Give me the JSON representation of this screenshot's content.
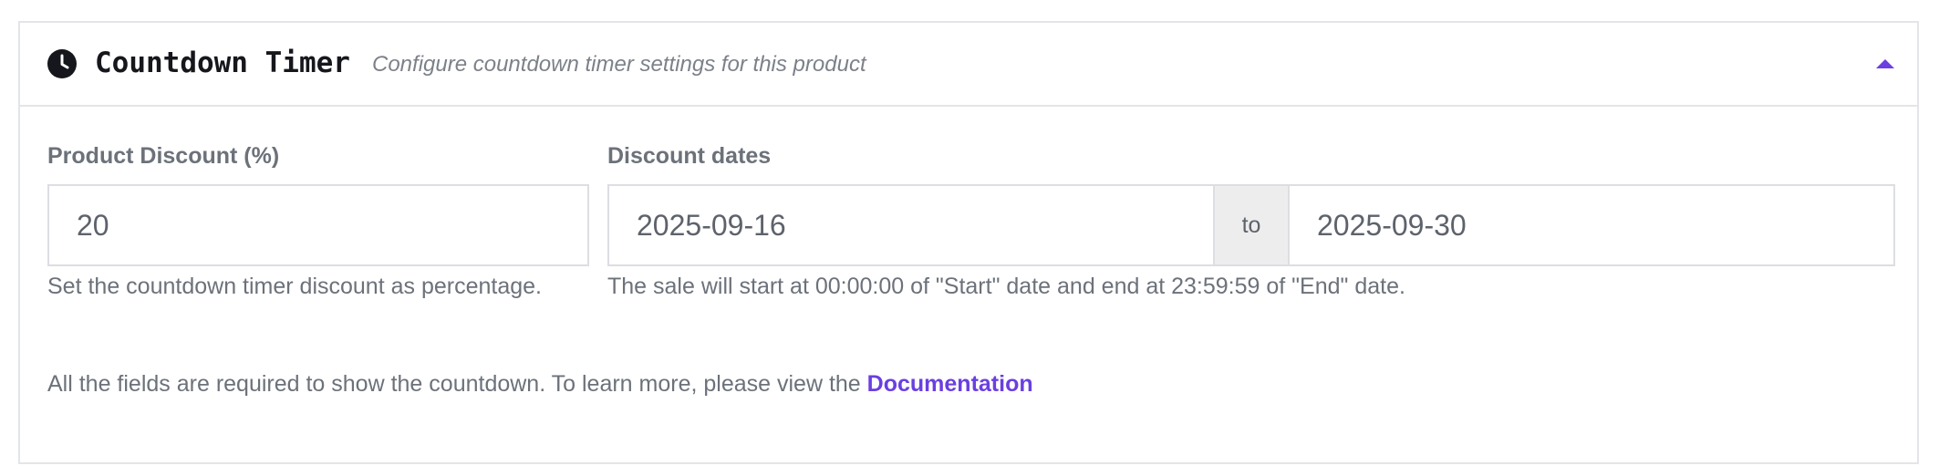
{
  "header": {
    "title": "Countdown Timer",
    "subtitle": "Configure countdown timer settings for this product",
    "icon": "clock-icon",
    "toggle_icon": "chevron-up-icon",
    "accent_color": "#6b3fe0"
  },
  "discount": {
    "label": "Product Discount (%)",
    "value": "20",
    "help": "Set the countdown timer discount as percentage."
  },
  "dates": {
    "label": "Discount dates",
    "start": "2025-09-16",
    "separator": "to",
    "end": "2025-09-30",
    "help": "The sale will start at 00:00:00 of \"Start\" date and end at 23:59:59 of \"End\" date."
  },
  "footer": {
    "note": "All the fields are required to show the countdown. To learn more, please view the ",
    "link_label": "Documentation"
  }
}
